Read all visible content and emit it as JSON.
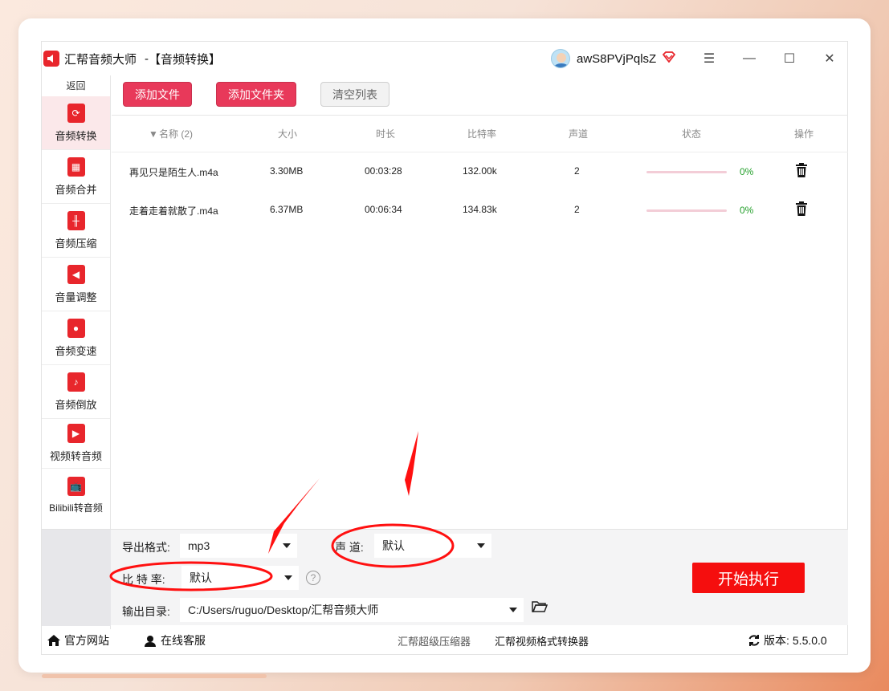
{
  "title": {
    "app_name": "汇帮音频大师",
    "separator": "-",
    "module": "【音频转换】",
    "logo_icon": "speaker-logo-icon"
  },
  "user": {
    "name": "awS8PVjPqlsZ",
    "vip_icon": "diamond-vip-icon"
  },
  "window_controls": {
    "menu_icon": "☰",
    "minimize_icon": "—",
    "maximize_icon": "☐",
    "close_icon": "✕"
  },
  "sidebar": {
    "back_label": "返回",
    "items": [
      {
        "label": "音频转换",
        "icon": "audio-convert-icon",
        "active": true
      },
      {
        "label": "音频合并",
        "icon": "audio-merge-icon",
        "active": false
      },
      {
        "label": "音频压缩",
        "icon": "audio-compress-icon",
        "active": false
      },
      {
        "label": "音量调整",
        "icon": "volume-adjust-icon",
        "active": false
      },
      {
        "label": "音频变速",
        "icon": "audio-speed-icon",
        "active": false
      },
      {
        "label": "音频倒放",
        "icon": "audio-reverse-icon",
        "active": false
      },
      {
        "label": "视频转音频",
        "icon": "video-to-audio-icon",
        "active": false
      },
      {
        "label": "Bilibili转音频",
        "icon": "bilibili-icon",
        "active": false
      }
    ]
  },
  "toolbar": {
    "add_file_label": "添加文件",
    "add_folder_label": "添加文件夹",
    "clear_list_label": "清空列表"
  },
  "table": {
    "headers": {
      "name": "名称 (2)",
      "size": "大小",
      "duration": "时长",
      "bitrate": "比特率",
      "channel": "声道",
      "status": "状态",
      "action": "操作"
    },
    "rows": [
      {
        "name": "再见只是陌生人.m4a",
        "size": "3.30MB",
        "duration": "00:03:28",
        "bitrate": "132.00k",
        "channel": "2",
        "progress": "0%"
      },
      {
        "name": "走着走着就散了.m4a",
        "size": "6.37MB",
        "duration": "00:06:34",
        "bitrate": "134.83k",
        "channel": "2",
        "progress": "0%"
      }
    ]
  },
  "settings": {
    "format_label": "导出格式:",
    "format_value": "mp3",
    "channel_label": "声 道:",
    "channel_value": "默认",
    "bitrate_label": "比 特 率:",
    "bitrate_value": "默认",
    "help_icon": "?",
    "output_label": "输出目录:",
    "output_value": "C:/Users/ruguo/Desktop/汇帮音频大师",
    "folder_icon": "folder-open-icon",
    "start_label": "开始执行"
  },
  "statusbar": {
    "website_label": "官方网站",
    "service_label": "在线客服",
    "link1": "汇帮超级压缩器",
    "link2": "汇帮视频格式转换器",
    "version_label": "版本:",
    "version_value": "5.5.0.0"
  },
  "colors": {
    "accent_red": "#e8262c",
    "button_red": "#e8395a",
    "start_red": "#f50e0e",
    "progress_green": "#25a02c",
    "annotation_red": "#ff1010"
  }
}
